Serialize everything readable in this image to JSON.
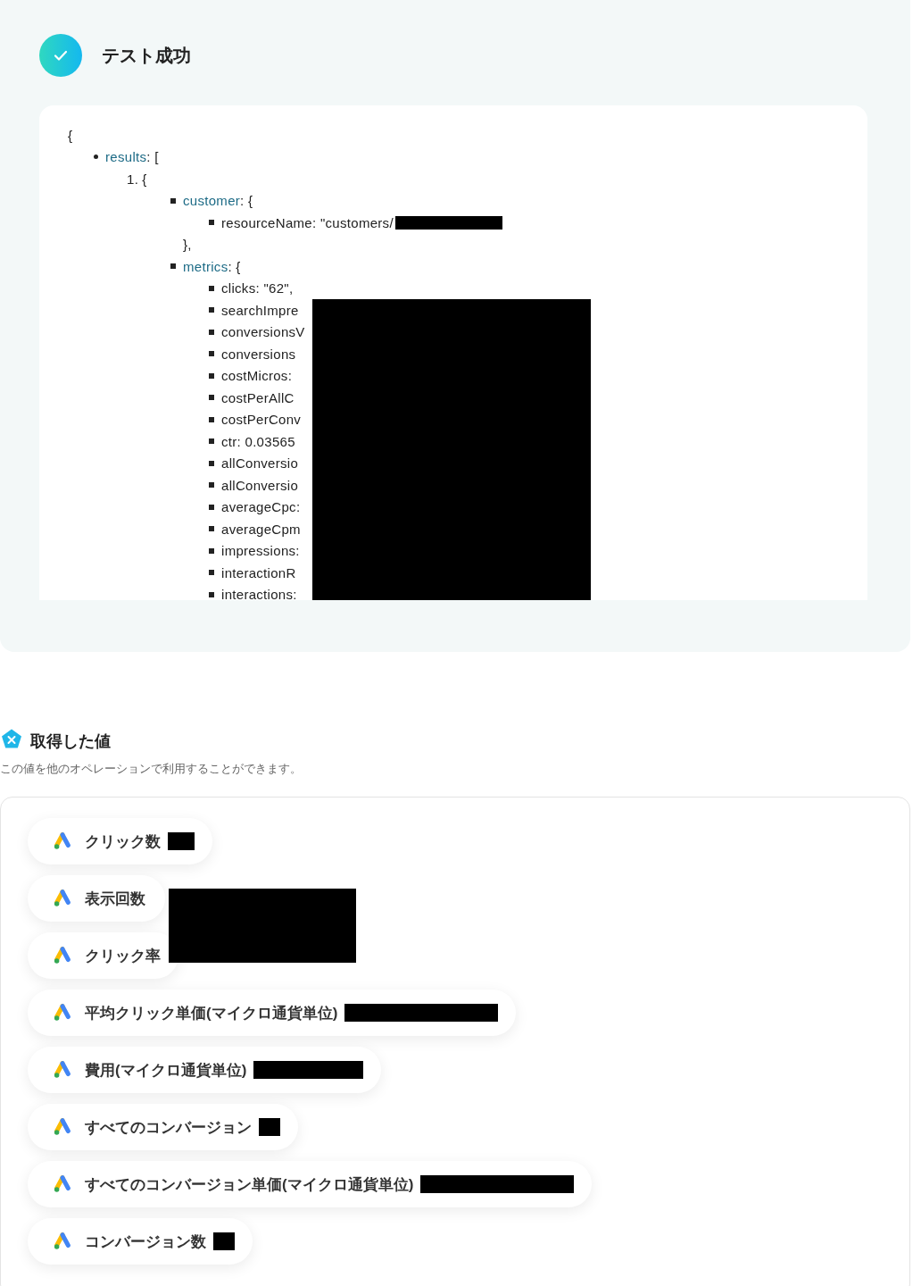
{
  "result": {
    "success": true,
    "title": "テスト成功"
  },
  "output": {
    "open": "{",
    "items": [
      {
        "kind": "disc",
        "key": "results",
        "rest": ": [",
        "children": [
          {
            "kind": "number",
            "number": "1.",
            "rest": "{",
            "children": [
              {
                "kind": "square",
                "key": "customer",
                "rest": ": {",
                "close": "},",
                "children": [
                  {
                    "kind": "square",
                    "text": "resourceName: \"customers/",
                    "redacted": true
                  }
                ]
              },
              {
                "kind": "square",
                "key": "metrics",
                "rest": ": {",
                "children": [
                  {
                    "kind": "square",
                    "text": "clicks: \"62\","
                  },
                  {
                    "kind": "square",
                    "text": "searchImpre",
                    "redacted": true
                  },
                  {
                    "kind": "square",
                    "text": "conversionsV",
                    "redacted": true
                  },
                  {
                    "kind": "square",
                    "text": "conversions",
                    "redacted": true
                  },
                  {
                    "kind": "square",
                    "text": "costMicros:",
                    "redacted": true
                  },
                  {
                    "kind": "square",
                    "text": "costPerAllC",
                    "redacted": true
                  },
                  {
                    "kind": "square",
                    "text": "costPerConv",
                    "redacted": true
                  },
                  {
                    "kind": "square",
                    "text": "ctr: 0.03565",
                    "redacted": true
                  },
                  {
                    "kind": "square",
                    "text": "allConversio",
                    "redacted": true
                  },
                  {
                    "kind": "square",
                    "text": "allConversio",
                    "redacted": true
                  },
                  {
                    "kind": "square",
                    "text": "averageCpc:",
                    "redacted": true
                  },
                  {
                    "kind": "square",
                    "text": "averageCpm",
                    "redacted": true
                  },
                  {
                    "kind": "square",
                    "text": "impressions:",
                    "redacted": true
                  },
                  {
                    "kind": "square",
                    "text": "interactionR",
                    "redacted": true
                  },
                  {
                    "kind": "square",
                    "text": "interactions:",
                    "redacted": true
                  }
                ]
              }
            ]
          }
        ]
      }
    ]
  },
  "values": {
    "title": "取得した値",
    "description": "この値を他のオペレーションで利用することができます。",
    "items": [
      {
        "kind": "short",
        "label": "クリック数"
      },
      {
        "kind": "block",
        "label": "表示回数"
      },
      {
        "kind": "plain",
        "label": "クリック率"
      },
      {
        "kind": "long",
        "label": "平均クリック単価(マイクロ通貨単位)"
      },
      {
        "kind": "medium",
        "label": "費用(マイクロ通貨単位)"
      },
      {
        "kind": "tiny",
        "label": "すべてのコンバージョン"
      },
      {
        "kind": "long",
        "label": "すべてのコンバージョン単価(マイクロ通貨単位)"
      },
      {
        "kind": "tiny",
        "label": "コンバージョン数"
      }
    ]
  }
}
